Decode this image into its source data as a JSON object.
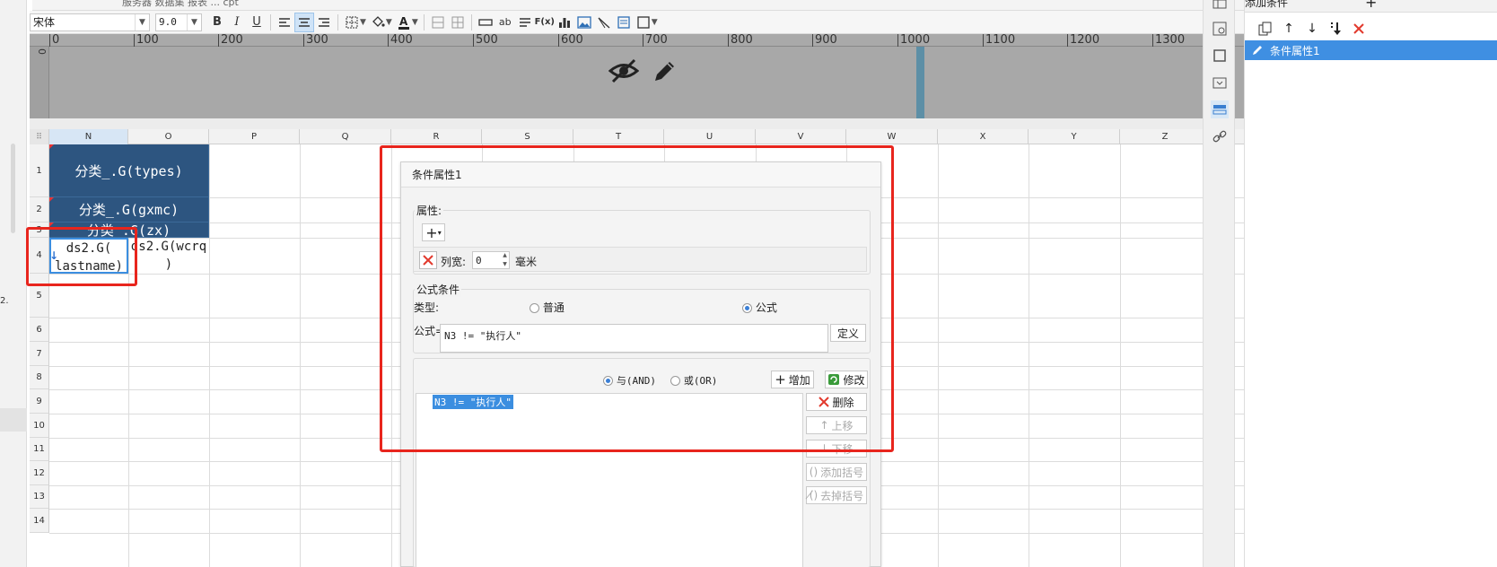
{
  "top_tab": {
    "title": "服务器 数据集 报表 ... cpt"
  },
  "toolbar": {
    "font_family": "宋体",
    "font_size": "9.0",
    "bold": "B",
    "italic": "I",
    "underline": "U",
    "text_tool": "ab",
    "formula_tool": "F(x)"
  },
  "ruler": {
    "marks": [
      "0",
      "100",
      "200",
      "300",
      "400",
      "500",
      "600",
      "700",
      "800",
      "900",
      "1000",
      "1100",
      "1200",
      "1300"
    ],
    "vertical_zero": "0"
  },
  "grid": {
    "columns": [
      "N",
      "O",
      "P",
      "Q",
      "R",
      "S",
      "T",
      "U",
      "V",
      "W",
      "X",
      "Y",
      "Z"
    ],
    "rows": [
      "1",
      "2",
      "3",
      "4",
      "5",
      "6",
      "7",
      "8",
      "9",
      "10",
      "11",
      "12",
      "13",
      "14"
    ],
    "cells": {
      "n1": "分类_.G(types)",
      "n2": "分类_.G(gxmc)",
      "n3": "分类_.G(zx)",
      "n4_line1": "ds2.G(",
      "n4_line2": "lastname)",
      "o4_line1": "ds2.G(wcrq",
      "o4_line2": ")"
    },
    "side_marker": "2."
  },
  "dialog": {
    "title": "条件属性1",
    "attribute_legend": "属性:",
    "column_width_label": "列宽:",
    "column_width_value": "0",
    "unit": "毫米",
    "formula_condition_legend": "公式条件",
    "type_label": "类型:",
    "type_normal": "普通",
    "type_formula": "公式",
    "formula_label": "公式=",
    "formula_value": "N3 != \"执行人\"",
    "define_button": "定义",
    "and_label": "与(AND)",
    "or_label": "或(OR)",
    "add_button": "增加",
    "modify_button": "修改",
    "condition_list": [
      "N3 != \"执行人\""
    ],
    "delete_button": "删除",
    "move_up_button": "上移",
    "move_down_button": "下移",
    "add_bracket_button": "添加括号",
    "remove_bracket_button": "去掉括号"
  },
  "right_panel": {
    "title": "添加条件",
    "add_symbol": "+",
    "items": [
      "条件属性1"
    ]
  },
  "colors": {
    "accent": "#3f8fe2",
    "dark_cell": "#2d5580",
    "highlight_red": "#e8251d",
    "selection_blue": "#3b7fd6"
  }
}
